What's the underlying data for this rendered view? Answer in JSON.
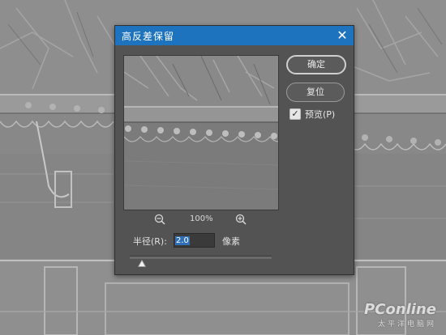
{
  "dialog": {
    "title": "高反差保留",
    "close_glyph": "✕",
    "ok_label": "确定",
    "reset_label": "复位",
    "preview": {
      "checked": true,
      "label": "预览(P)"
    },
    "zoom": {
      "level": "100%"
    },
    "radius": {
      "label": "半径(R):",
      "value": "2.0",
      "unit": "像素",
      "slider_fraction": 0.03
    }
  },
  "watermark": {
    "brand": "PConline",
    "subtitle": "太平洋电脑网"
  },
  "colors": {
    "titlebar": "#1e73be",
    "dialog_bg": "#535353",
    "selection": "#2f6fb8"
  }
}
